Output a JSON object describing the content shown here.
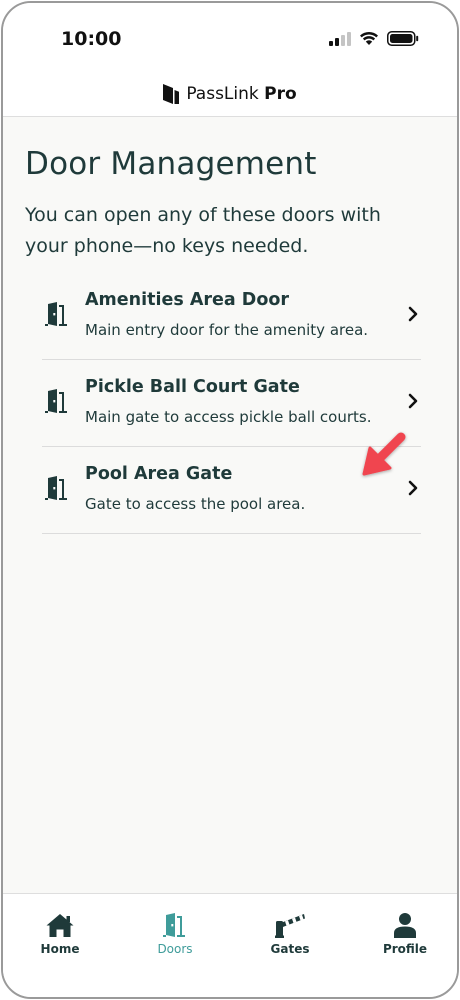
{
  "status_bar": {
    "time": "10:00",
    "icons": [
      "signal-icon",
      "wifi-icon",
      "battery-icon"
    ]
  },
  "header": {
    "brand_prefix": "PassLink",
    "brand_suffix": "Pro",
    "logo_icon": "passlink-logo-icon"
  },
  "main": {
    "title": "Door Management",
    "description": "You can open any of these doors with your phone—no keys needed.",
    "doors": [
      {
        "name": "Amenities Area Door",
        "description": "Main entry door for the amenity area.",
        "icon": "door-icon"
      },
      {
        "name": "Pickle Ball Court Gate",
        "description": "Main gate to access pickle ball courts.",
        "icon": "door-icon"
      },
      {
        "name": "Pool Area Gate",
        "description": "Gate to access the pool area.",
        "icon": "door-icon"
      }
    ]
  },
  "nav": {
    "items": [
      {
        "label": "Home",
        "icon": "home-icon",
        "active": false
      },
      {
        "label": "Doors",
        "icon": "door-icon",
        "active": true
      },
      {
        "label": "Gates",
        "icon": "gate-barrier-icon",
        "active": false
      },
      {
        "label": "Profile",
        "icon": "person-icon",
        "active": false
      }
    ]
  },
  "colors": {
    "text": "#1f3a3a",
    "accent": "#3f9c9a",
    "background": "#f9f9f7",
    "pointer": "#f0454f"
  }
}
